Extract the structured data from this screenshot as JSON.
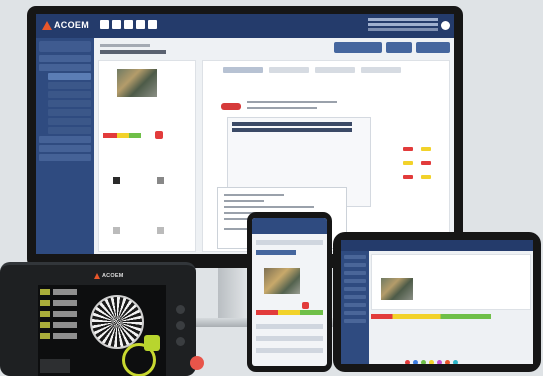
{
  "brand": {
    "name": "ACOEM",
    "accent": "#e8562a",
    "nav_color": "#243b6b"
  },
  "icons": [
    "logo-triangle-icon",
    "grid-icon",
    "user-icon",
    "pencil-icon"
  ],
  "colors": {
    "alarm_red": "#e23b3b",
    "warning_yellow": "#f2d22a",
    "ok_green": "#6fbf48",
    "device_button_green": "#b8d52e"
  }
}
